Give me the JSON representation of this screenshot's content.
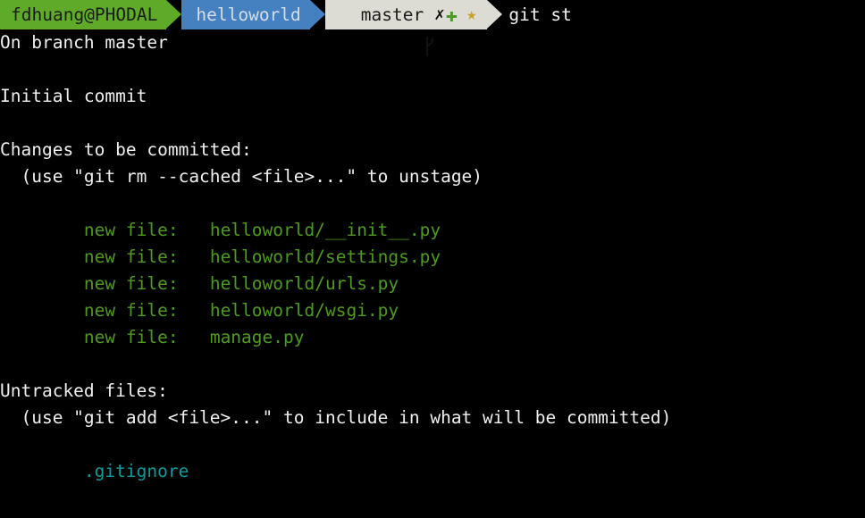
{
  "terminal": {
    "background": "#000000",
    "foreground": "#f0f0f0",
    "green": "#4e9a1e",
    "cyan": "#0e9a9a"
  },
  "prompt": {
    "user_host": "fdhuang@PHODAL",
    "user_bg": "#5faa28",
    "directory": "helloworld",
    "dir_bg": "#4580c0",
    "git_branch": "master",
    "git_bg": "#dcdcd4",
    "branch_icon": "git-branch-icon",
    "flags": {
      "dirty": "✗",
      "staged": "✚",
      "stashed": "★"
    },
    "command": "git st"
  },
  "output": {
    "branch_line": "On branch master",
    "initial_commit": "Initial commit",
    "staged_header": "Changes to be committed:",
    "staged_hint": "  (use \"git rm --cached <file>...\" to unstage)",
    "staged_files": [
      {
        "status": "new file:",
        "path": "helloworld/__init__.py"
      },
      {
        "status": "new file:",
        "path": "helloworld/settings.py"
      },
      {
        "status": "new file:",
        "path": "helloworld/urls.py"
      },
      {
        "status": "new file:",
        "path": "helloworld/wsgi.py"
      },
      {
        "status": "new file:",
        "path": "manage.py"
      }
    ],
    "untracked_header": "Untracked files:",
    "untracked_hint": "  (use \"git add <file>...\" to include in what will be committed)",
    "untracked_files": [
      ".gitignore"
    ],
    "indent": "        ",
    "status_pad": "   "
  }
}
